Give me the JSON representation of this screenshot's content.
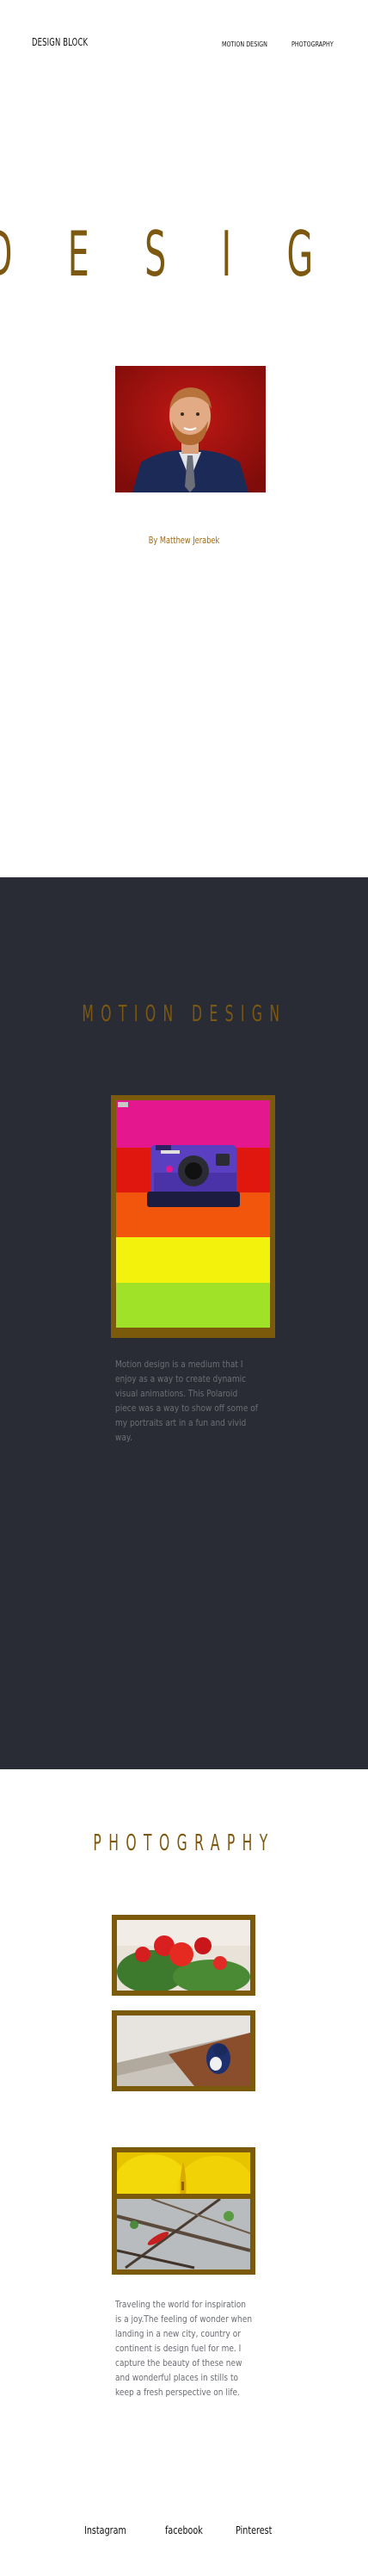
{
  "header": {
    "brand": "DESIGN BLOCK",
    "nav": [
      {
        "label": "MOTION DESIGN"
      },
      {
        "label": "PHOTOGRAPHY"
      }
    ]
  },
  "hero": {
    "marquee_text": "D E S I G N  D"
  },
  "portrait": {
    "byline": "By Matthew Jerabek"
  },
  "motion": {
    "title": "MOTION DESIGN",
    "description": "Motion design is a medium that I enjoy  as a way to create dynamic visual animations. This Polaroid piece was a way to show off some of my portraits art in a fun and vivid way.",
    "stripe_colors": [
      "#e5178f",
      "#e0170f",
      "#f2560c",
      "#f2f20c",
      "#9fe227"
    ]
  },
  "photography": {
    "title": "PHOTOGRAPHY",
    "description": "Traveling the world for inspiration is a joy.The feeling of wonder when landing in a new city, country or continent is design fuel for me. I capture the beauty of these new and wonderful places in stills to keep a fresh perspective on life.",
    "photos": [
      {
        "subject": "red flower"
      },
      {
        "subject": "bird on ledge"
      },
      {
        "subject": "yellow flower"
      },
      {
        "subject": "red lizard on branches"
      }
    ]
  },
  "footer": {
    "links": [
      {
        "label": "Instagram"
      },
      {
        "label": "facebook"
      },
      {
        "label": "Pinterest"
      }
    ]
  },
  "colors": {
    "accent": "#7d5810",
    "dark_section": "#292c34",
    "text_muted": "#6b6e75"
  }
}
